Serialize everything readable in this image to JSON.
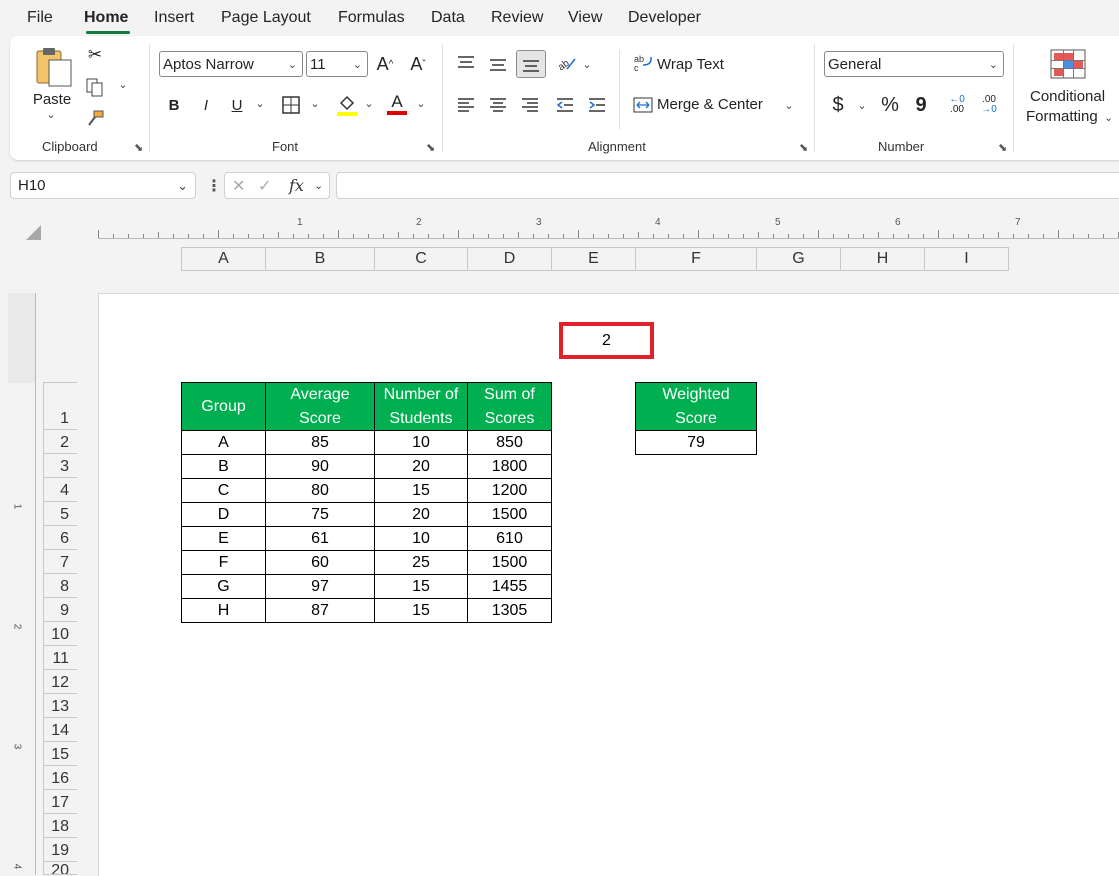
{
  "menu": {
    "tabs": [
      "File",
      "Home",
      "Insert",
      "Page Layout",
      "Formulas",
      "Data",
      "Review",
      "View",
      "Developer"
    ],
    "active": "Home"
  },
  "ribbon": {
    "clipboard": {
      "label": "Clipboard",
      "paste_label": "Paste"
    },
    "font": {
      "label": "Font",
      "font_name": "Aptos Narrow",
      "font_size": "11",
      "bold": "B",
      "italic": "I",
      "underline": "U",
      "grow": "A^",
      "shrink": "Aˇ",
      "font_color_letter": "A",
      "fill_color": "#ffff00",
      "font_color": "#e00000"
    },
    "alignment": {
      "label": "Alignment",
      "wrap_text": "Wrap Text",
      "merge_center": "Merge & Center"
    },
    "number": {
      "label": "Number",
      "format": "General",
      "currency": "$",
      "percent": "%",
      "comma": "9",
      "inc_decimal": ".00",
      "dec_decimal": ".00"
    },
    "styles": {
      "conditional_line1": "Conditional",
      "conditional_line2": "Formatting"
    }
  },
  "formula_bar": {
    "name_box": "H10",
    "fx": "fx",
    "value": ""
  },
  "ruler": {
    "numbers": [
      "1",
      "2",
      "3",
      "4",
      "5",
      "6",
      "7"
    ],
    "vnumbers": [
      "1",
      "2",
      "3",
      "4"
    ]
  },
  "columns": [
    "A",
    "B",
    "C",
    "D",
    "E",
    "F",
    "G",
    "H",
    "I"
  ],
  "rows": [
    "1",
    "2",
    "3",
    "4",
    "5",
    "6",
    "7",
    "8",
    "9",
    "10",
    "11",
    "12",
    "13",
    "14",
    "15",
    "16",
    "17",
    "18",
    "19",
    "20"
  ],
  "highlight_value": "2",
  "table": {
    "headers": [
      "Group",
      "Average Score",
      "Number of Students",
      "Sum of Scores"
    ],
    "header_lines": [
      [
        "Group"
      ],
      [
        "Average",
        "Score"
      ],
      [
        "Number of",
        "Students"
      ],
      [
        "Sum of",
        "Scores"
      ]
    ],
    "rows": [
      [
        "A",
        "85",
        "10",
        "850"
      ],
      [
        "B",
        "90",
        "20",
        "1800"
      ],
      [
        "C",
        "80",
        "15",
        "1200"
      ],
      [
        "D",
        "75",
        "20",
        "1500"
      ],
      [
        "E",
        "61",
        "10",
        "610"
      ],
      [
        "F",
        "60",
        "25",
        "1500"
      ],
      [
        "G",
        "97",
        "15",
        "1455"
      ],
      [
        "H",
        "87",
        "15",
        "1305"
      ]
    ]
  },
  "weighted": {
    "header_line1": "Weighted",
    "header_line2": "Score",
    "value": "79"
  },
  "colors": {
    "header_green": "#00b050",
    "highlight_red": "#e0202a",
    "tab_underline": "#117a3c"
  }
}
